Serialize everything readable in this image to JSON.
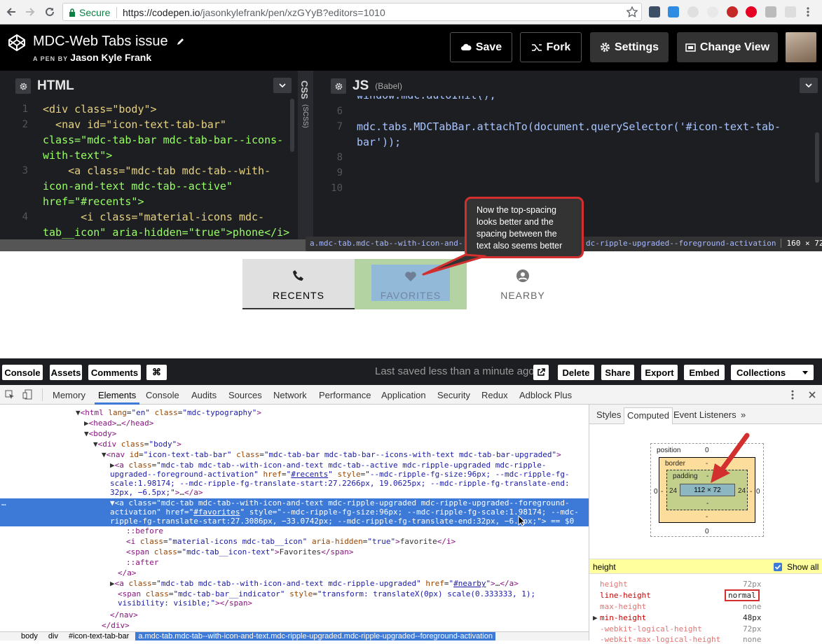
{
  "browser": {
    "secure_label": "Secure",
    "url_host": "https://codepen.io",
    "url_path": "/jasonkylefrank/pen/xzGYyB?editors=1010"
  },
  "codepen": {
    "title": "MDC-Web Tabs issue",
    "subtitle_prefix": "A PEN BY",
    "author": "Jason Kyle Frank",
    "buttons": {
      "save": "Save",
      "fork": "Fork",
      "settings": "Settings",
      "change_view": "Change View"
    }
  },
  "html_pane": {
    "title": "HTML",
    "line_numbers": [
      "1",
      "2",
      "3",
      "4"
    ],
    "lines": [
      "<div class=\"body\">",
      "  <nav id=\"icon-text-tab-bar\"",
      "class=\"mdc-tab-bar mdc-tab-bar--icons-",
      "with-text\">",
      "    <a class=\"mdc-tab mdc-tab--with-",
      "icon-and-text mdc-tab--active\"",
      "href=\"#recents\">",
      "      <i class=\"material-icons mdc-",
      "tab__icon\" aria-hidden=\"true\">phone</i>"
    ]
  },
  "css_pane": {
    "title": "CSS",
    "sub": "(SCSS)"
  },
  "js_pane": {
    "title": "JS",
    "sub": "(Babel)",
    "line_numbers": [
      "6",
      "7",
      "8",
      "9",
      "10"
    ],
    "partial_line": "window.mdc.autoInit();",
    "line7a": "mdc.tabs.MDCTabBar.attachTo(document.querySelector('#icon-text-tab-",
    "line7b": "bar'));"
  },
  "preview": {
    "tooltip_selector": "a.mdc-tab.mdc-tab--with-icon-and-",
    "tooltip_selector_tail": "dc-ripple-upgraded--foreground-activation",
    "tooltip_size": "160 × 72",
    "tabs": [
      {
        "label": "RECENTS",
        "icon": "phone-icon"
      },
      {
        "label": "FAVORITES",
        "icon": "heart-icon"
      },
      {
        "label": "NEARBY",
        "icon": "account-circle-icon"
      }
    ],
    "callout": "Now the top-spacing looks better and the spacing between the text also seems better"
  },
  "footer": {
    "console": "Console",
    "assets": "Assets",
    "comments": "Comments",
    "shortcut": "⌘",
    "saved": "Last saved less than a minute ago",
    "delete": "Delete",
    "share": "Share",
    "export": "Export",
    "embed": "Embed",
    "collections": "Collections"
  },
  "devtools": {
    "tabs": [
      "Memory",
      "Elements",
      "Console",
      "Audits",
      "Sources",
      "Network",
      "Performance",
      "Application",
      "Security",
      "Redux",
      "Adblock Plus"
    ],
    "active_tab": "Elements",
    "side_tabs": [
      "Styles",
      "Computed",
      "Event Listeners"
    ],
    "box": {
      "position": "position",
      "position_val": "0",
      "border": "border",
      "border_val": "-",
      "padding": "padding",
      "padding_val": "-",
      "content": "112 × 72",
      "pad_left": "24",
      "pad_right": "24",
      "pad_bottom": "-",
      "border_bottom": "-",
      "pos_left": "0",
      "pos_right": "0",
      "pos_bottom": "0",
      "side_dash_l": "-",
      "side_dash_r": "-"
    },
    "filter_value": "height",
    "show_all": "Show all",
    "props": [
      {
        "name": "height",
        "value": "72px"
      },
      {
        "name": "line-height",
        "value": "normal"
      },
      {
        "name": "max-height",
        "value": "none"
      },
      {
        "name": "min-height",
        "value": "48px"
      },
      {
        "name": "-webkit-logical-height",
        "value": "72px"
      },
      {
        "name": "-webkit-max-logical-height",
        "value": "none"
      }
    ],
    "breadcrumbs": [
      "body",
      "div",
      "#icon-text-tab-bar",
      "a.mdc-tab.mdc-tab--with-icon-and-text.mdc-ripple-upgraded.mdc-ripple-upgraded--foreground-activation"
    ]
  }
}
